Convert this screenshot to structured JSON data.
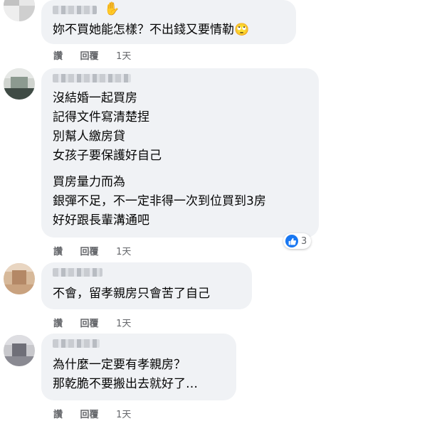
{
  "comments": [
    {
      "lines": [
        "妳不買她能怎樣？不出錢又要情勒🙄"
      ],
      "actions": {
        "like": "讚",
        "reply": "回覆",
        "time": "1天"
      }
    },
    {
      "lines": [
        "沒結婚一起買房",
        "記得文件寫清楚捏",
        "別幫人繳房貸",
        "女孩子要保護好自己"
      ],
      "lines2": [
        "買房量力而為",
        "銀彈不足，不一定非得一次到位買到3房",
        "好好跟長輩溝通吧"
      ],
      "reaction_count": "3",
      "actions": {
        "like": "讚",
        "reply": "回覆",
        "time": "1天"
      }
    },
    {
      "lines": [
        "不會，留孝親房只會苦了自己"
      ],
      "actions": {
        "like": "讚",
        "reply": "回覆",
        "time": "1天"
      }
    },
    {
      "lines": [
        "為什麼一定要有孝親房？",
        "那乾脆不要搬出去就好了…"
      ],
      "actions": {
        "like": "讚",
        "reply": "回覆",
        "time": "1天"
      }
    }
  ],
  "colors": {
    "bubble": "#f0f2f5",
    "action_text": "#65676b",
    "like_blue": "#1877f2"
  }
}
